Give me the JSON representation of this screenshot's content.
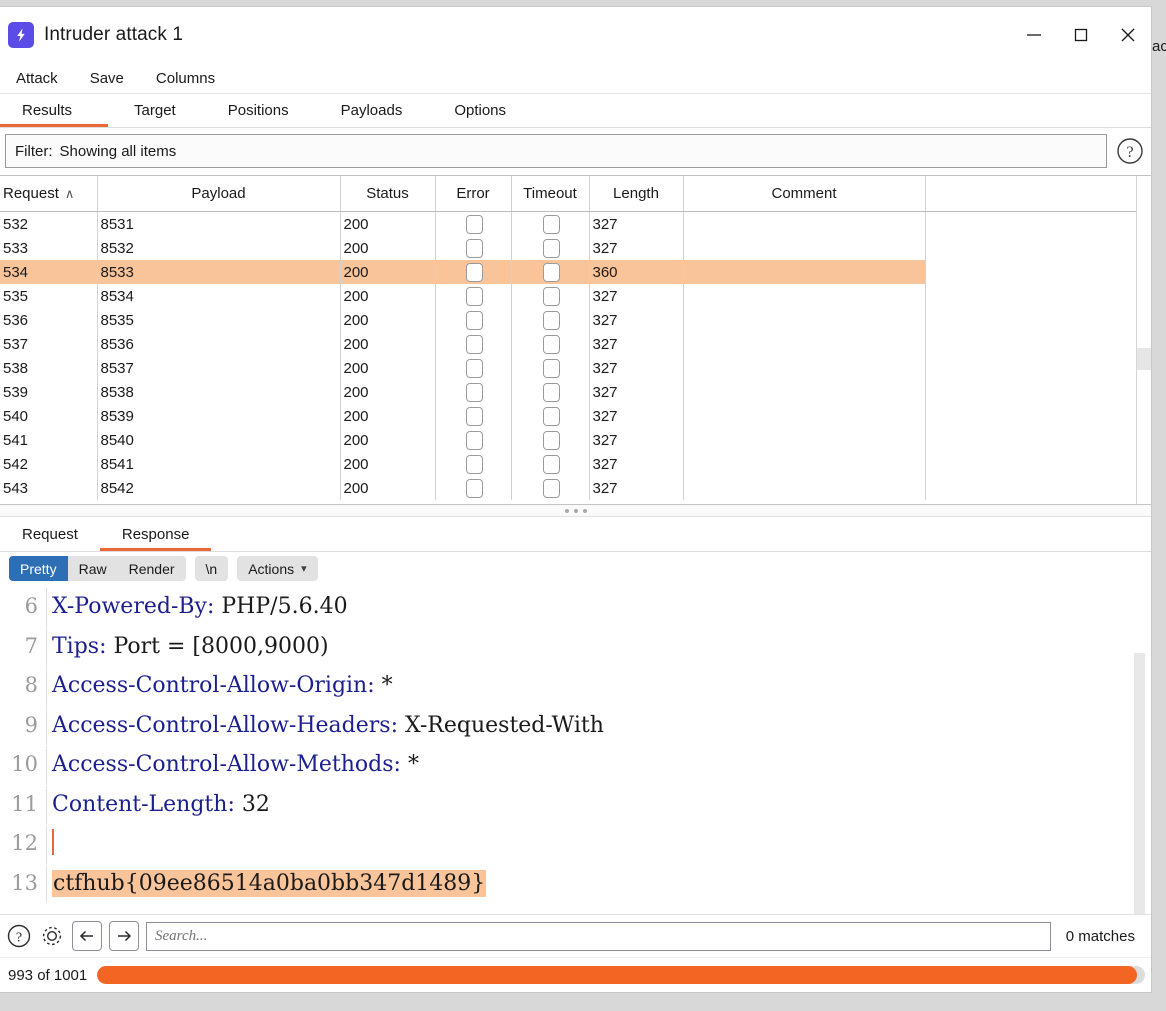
{
  "desktop": {
    "background_text": "ac"
  },
  "window": {
    "title": "Intruder attack 1",
    "app_icon": "lightning-bolt-icon",
    "controls": {
      "minimize": "minimize-icon",
      "maximize": "maximize-icon",
      "close": "close-icon"
    }
  },
  "menubar": {
    "items": [
      {
        "label": "Attack"
      },
      {
        "label": "Save"
      },
      {
        "label": "Columns"
      }
    ]
  },
  "tabs": [
    {
      "label": "Results",
      "active": true
    },
    {
      "label": "Target",
      "active": false
    },
    {
      "label": "Positions",
      "active": false
    },
    {
      "label": "Payloads",
      "active": false
    },
    {
      "label": "Options",
      "active": false
    }
  ],
  "filter": {
    "label": "Filter:",
    "value": "Showing all items",
    "help_icon": "question-mark-icon"
  },
  "results_table": {
    "columns": [
      {
        "label": "Request",
        "sort": "∧"
      },
      {
        "label": "Payload"
      },
      {
        "label": "Status"
      },
      {
        "label": "Error"
      },
      {
        "label": "Timeout"
      },
      {
        "label": "Length"
      },
      {
        "label": "Comment"
      },
      {
        "label": ""
      }
    ],
    "rows": [
      {
        "request": "532",
        "payload": "8531",
        "status": "200",
        "error": false,
        "timeout": false,
        "length": "327",
        "comment": "",
        "highlight": false
      },
      {
        "request": "533",
        "payload": "8532",
        "status": "200",
        "error": false,
        "timeout": false,
        "length": "327",
        "comment": "",
        "highlight": false
      },
      {
        "request": "534",
        "payload": "8533",
        "status": "200",
        "error": false,
        "timeout": false,
        "length": "360",
        "comment": "",
        "highlight": true
      },
      {
        "request": "535",
        "payload": "8534",
        "status": "200",
        "error": false,
        "timeout": false,
        "length": "327",
        "comment": "",
        "highlight": false
      },
      {
        "request": "536",
        "payload": "8535",
        "status": "200",
        "error": false,
        "timeout": false,
        "length": "327",
        "comment": "",
        "highlight": false
      },
      {
        "request": "537",
        "payload": "8536",
        "status": "200",
        "error": false,
        "timeout": false,
        "length": "327",
        "comment": "",
        "highlight": false
      },
      {
        "request": "538",
        "payload": "8537",
        "status": "200",
        "error": false,
        "timeout": false,
        "length": "327",
        "comment": "",
        "highlight": false
      },
      {
        "request": "539",
        "payload": "8538",
        "status": "200",
        "error": false,
        "timeout": false,
        "length": "327",
        "comment": "",
        "highlight": false
      },
      {
        "request": "540",
        "payload": "8539",
        "status": "200",
        "error": false,
        "timeout": false,
        "length": "327",
        "comment": "",
        "highlight": false
      },
      {
        "request": "541",
        "payload": "8540",
        "status": "200",
        "error": false,
        "timeout": false,
        "length": "327",
        "comment": "",
        "highlight": false
      },
      {
        "request": "542",
        "payload": "8541",
        "status": "200",
        "error": false,
        "timeout": false,
        "length": "327",
        "comment": "",
        "highlight": false
      },
      {
        "request": "543",
        "payload": "8542",
        "status": "200",
        "error": false,
        "timeout": false,
        "length": "327",
        "comment": "",
        "highlight": false
      }
    ]
  },
  "message_tabs": [
    {
      "label": "Request",
      "active": false
    },
    {
      "label": "Response",
      "active": true
    }
  ],
  "viewer_toolbar": {
    "segments": [
      {
        "label": "Pretty",
        "active": true
      },
      {
        "label": "Raw",
        "active": false
      },
      {
        "label": "Render",
        "active": false
      }
    ],
    "newline_button": "\\n",
    "actions_button": "Actions",
    "actions_caret": "chevron-down-icon"
  },
  "response": {
    "lines": [
      {
        "no": "6",
        "name": "X-Powered-By:",
        "value": " PHP/5.6.40"
      },
      {
        "no": "7",
        "name": "Tips:",
        "value": " Port = [8000,9000)"
      },
      {
        "no": "8",
        "name": "Access-Control-Allow-Origin:",
        "value": " *"
      },
      {
        "no": "9",
        "name": "Access-Control-Allow-Headers:",
        "value": " X-Requested-With"
      },
      {
        "no": "10",
        "name": "Access-Control-Allow-Methods:",
        "value": " *"
      },
      {
        "no": "11",
        "name": "Content-Length:",
        "value": " 32"
      },
      {
        "no": "12",
        "name": "",
        "value": "",
        "cursor": true
      },
      {
        "no": "13",
        "name": "",
        "value": "ctfhub{09ee86514a0ba0bb347d1489}",
        "highlight": true
      }
    ]
  },
  "search": {
    "help_icon": "question-mark-icon",
    "settings_icon": "gear-icon",
    "prev_icon": "arrow-left-icon",
    "next_icon": "arrow-right-icon",
    "placeholder": "Search...",
    "value": "",
    "matches": "0 matches"
  },
  "status": {
    "progress_text": "993 of 1001",
    "completed": 993,
    "total": 1001,
    "percent": 99.2
  },
  "colors": {
    "accent_orange": "#ec6737",
    "progress_orange": "#f26522",
    "highlight_peach": "#f9c49a",
    "selected_blue": "#2d6eb5",
    "header_blue": "#1b1f8f",
    "app_icon_purple": "#5b4ce8"
  }
}
